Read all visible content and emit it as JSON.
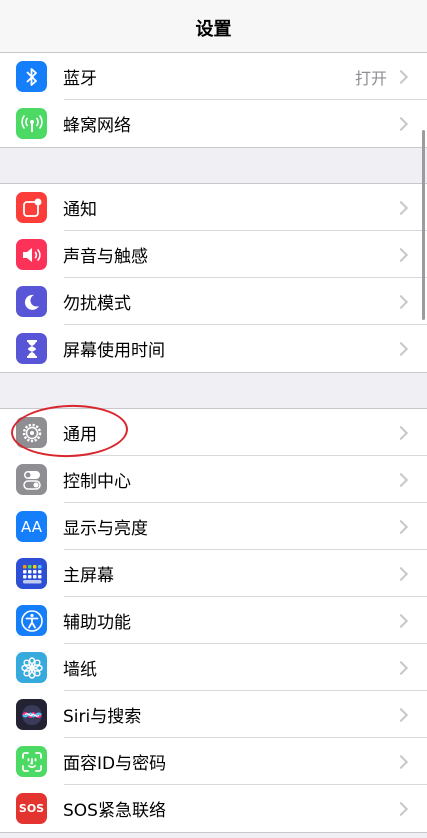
{
  "nav": {
    "title": "设置"
  },
  "groups": [
    {
      "rows": [
        {
          "label": "蓝牙",
          "value": "打开",
          "icon": "bluetooth-icon",
          "color": "#157efb"
        },
        {
          "label": "蜂窝网络",
          "icon": "cellular-antenna-icon",
          "color": "#4cd964"
        }
      ]
    },
    {
      "rows": [
        {
          "label": "通知",
          "icon": "notifications-icon",
          "color": "#fc3d39"
        },
        {
          "label": "声音与触感",
          "icon": "speaker-icon",
          "color": "#fd3259"
        },
        {
          "label": "勿扰模式",
          "icon": "moon-icon",
          "color": "#5856d6"
        },
        {
          "label": "屏幕使用时间",
          "icon": "hourglass-icon",
          "color": "#5856d6"
        }
      ]
    },
    {
      "rows": [
        {
          "label": "通用",
          "icon": "gear-icon",
          "color": "#8e8e93"
        },
        {
          "label": "控制中心",
          "icon": "toggles-icon",
          "color": "#8e8e93"
        },
        {
          "label": "显示与亮度",
          "icon": "text-size-icon",
          "color": "#157efb",
          "icon_text": "AA"
        },
        {
          "label": "主屏幕",
          "icon": "home-screen-grid-icon",
          "color": "#2d4fd6"
        },
        {
          "label": "辅助功能",
          "icon": "accessibility-icon",
          "color": "#157efb"
        },
        {
          "label": "墙纸",
          "icon": "flower-icon",
          "color": "#36aadc"
        },
        {
          "label": "Siri与搜索",
          "icon": "siri-icon",
          "color": "#222233"
        },
        {
          "label": "面容ID与密码",
          "icon": "face-id-icon",
          "color": "#4cd964"
        },
        {
          "label": "SOS紧急联络",
          "icon": "sos-icon",
          "color": "#e3342f",
          "icon_text": "SOS"
        }
      ]
    }
  ]
}
